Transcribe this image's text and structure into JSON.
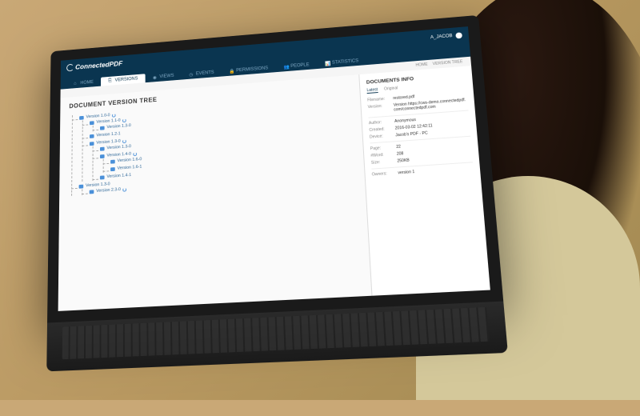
{
  "brand": "ConnectedPDF",
  "user": {
    "name": "A_JACOB"
  },
  "tabs": [
    {
      "icon": "home",
      "label": "HOME"
    },
    {
      "icon": "versions",
      "label": "VERSIONS"
    },
    {
      "icon": "views",
      "label": "VIEWS"
    },
    {
      "icon": "events",
      "label": "EVENTS"
    },
    {
      "icon": "permissions",
      "label": "PERMISSIONS"
    },
    {
      "icon": "people",
      "label": "PEOPLE"
    },
    {
      "icon": "statistics",
      "label": "STATISTICS"
    }
  ],
  "activeTab": 1,
  "breadcrumb": [
    "HOME",
    "VERSION TREE"
  ],
  "main": {
    "title": "DOCUMENT VERSION TREE"
  },
  "tree": [
    {
      "label": "Version 1.0-0",
      "children": [
        {
          "label": "Version 1.1-0",
          "children": [
            {
              "label": "Version 1.3-0"
            }
          ]
        },
        {
          "label": "Version 1.2-1"
        },
        {
          "label": "Version 1.3-0",
          "children": [
            {
              "label": "Version 1.3-0"
            },
            {
              "label": "Version 1.4-0",
              "children": [
                {
                  "label": "Version 1.6-0"
                },
                {
                  "label": "Version 1.6-1"
                }
              ]
            },
            {
              "label": "Version 1.4-1"
            }
          ]
        }
      ]
    },
    {
      "label": "Version 1.3-0",
      "children": [
        {
          "label": "Version 2.3-0"
        }
      ]
    }
  ],
  "sidebar": {
    "title": "DOCUMENTS INFO",
    "subtabs": [
      "Latest",
      "Original"
    ],
    "activeSubtab": 0,
    "info": {
      "filename_label": "Filename:",
      "filename": "restored.pdf",
      "version_label": "Version:",
      "version": "Version https://cws-demo.connectedpdf.com/connectedpdf.com",
      "author_label": "Author:",
      "author": "Anonymous",
      "created_label": "Created:",
      "created": "2016-03-02 12:42:11",
      "device_label": "Device:",
      "device": "Jacob's PDF - PC",
      "page_label": "Page:",
      "page": "22",
      "word_label": "#Word:",
      "word": "208",
      "size_label": "Size:",
      "size": "250KB",
      "owners_label": "Owners:",
      "owners": "version 1"
    }
  }
}
